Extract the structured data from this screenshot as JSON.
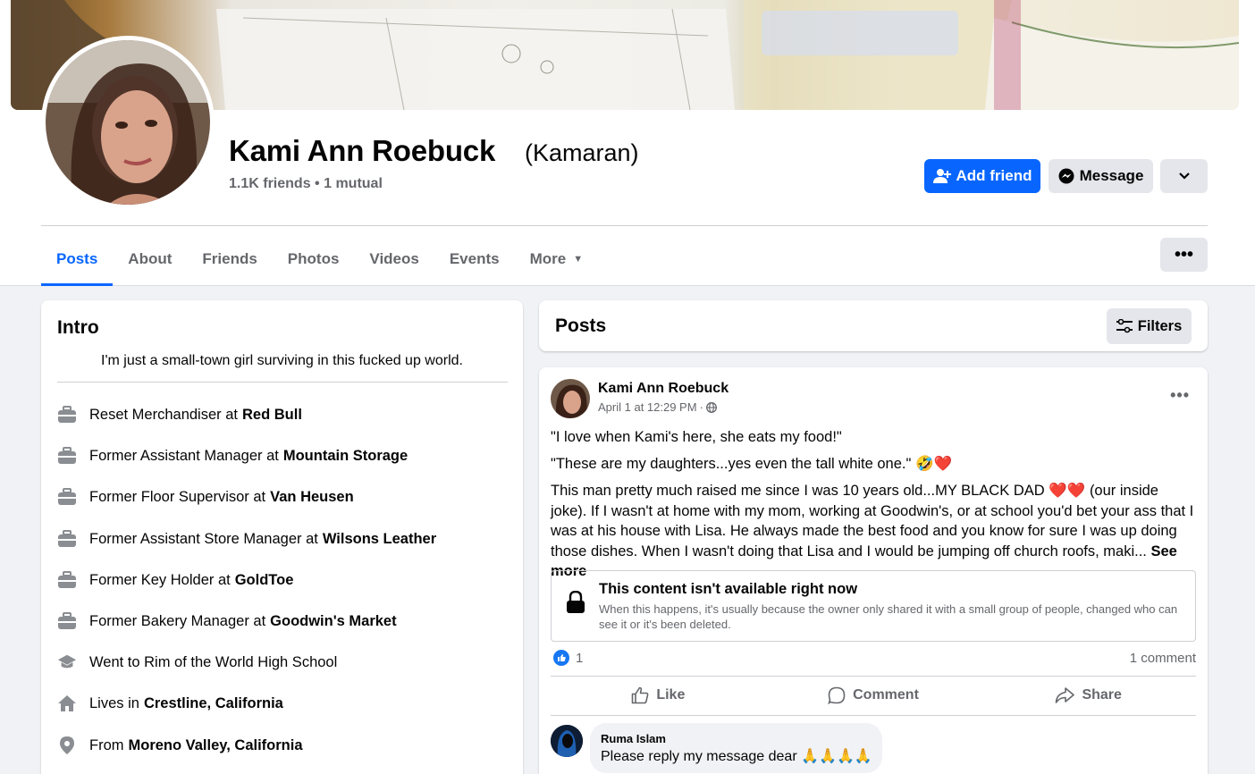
{
  "profile": {
    "name": "Kami Ann Roebuck",
    "alternate_name": "(Kamaran)",
    "friends_count": "1.1K friends",
    "mutual": "1 mutual"
  },
  "actions": {
    "add_friend": "Add friend",
    "message": "Message"
  },
  "tabs": [
    {
      "label": "Posts",
      "active": true
    },
    {
      "label": "About"
    },
    {
      "label": "Friends"
    },
    {
      "label": "Photos"
    },
    {
      "label": "Videos"
    },
    {
      "label": "Events"
    },
    {
      "label": "More"
    }
  ],
  "intro": {
    "title": "Intro",
    "bio": "I'm just a small-town girl surviving in this fucked up world.",
    "items": [
      {
        "icon": "briefcase-icon",
        "text": "Reset Merchandiser at",
        "bold": "Red Bull"
      },
      {
        "icon": "briefcase-icon",
        "text": "Former Assistant Manager at",
        "bold": "Mountain Storage"
      },
      {
        "icon": "briefcase-icon",
        "text": "Former Floor Supervisor at",
        "bold": "Van Heusen"
      },
      {
        "icon": "briefcase-icon",
        "text": "Former Assistant Store Manager at",
        "bold": "Wilsons Leather"
      },
      {
        "icon": "briefcase-icon",
        "text": "Former Key Holder at",
        "bold": "GoldToe"
      },
      {
        "icon": "briefcase-icon",
        "text": "Former Bakery Manager at",
        "bold": "Goodwin's Market"
      },
      {
        "icon": "graduation-cap-icon",
        "text": "Went to Rim of the World High School",
        "bold": ""
      },
      {
        "icon": "home-icon",
        "text": "Lives in",
        "bold": "Crestline, California"
      },
      {
        "icon": "location-pin-icon",
        "text": "From",
        "bold": "Moreno Valley, California"
      }
    ]
  },
  "posts_section": {
    "title": "Posts",
    "filters_label": "Filters"
  },
  "post": {
    "author": "Kami Ann Roebuck",
    "timestamp": "April 1 at 12:29 PM",
    "separator": "·",
    "paragraph1": "\"I love when Kami's here, she eats my food!\"",
    "paragraph2": "\"These are my daughters...yes even the tall white one.\"",
    "paragraph2_emoji": "🤣❤️",
    "paragraph3_a": "This man pretty much raised me since I was 10 years old...MY BLACK DAD",
    "paragraph3_emoji": "❤️❤️",
    "paragraph3_b": "(our inside joke). If I wasn't at home with my mom, working at Goodwin's, or at school you'd bet your ass that I was at his house with Lisa. He always made the best food and you know for sure I was up doing those dishes. When I wasn't doing that Lisa and I would be jumping off church roofs, maki...",
    "see_more": "See more",
    "unavailable_title": "This content isn't available right now",
    "unavailable_desc": "When this happens, it's usually because the owner only shared it with a small group of people, changed who can see it or it's been deleted.",
    "reaction_count": "1",
    "comment_count": "1 comment",
    "like_label": "Like",
    "comment_label": "Comment",
    "share_label": "Share"
  },
  "comment": {
    "author": "Ruma Islam",
    "text": "Please reply my message dear",
    "emoji": "🙏🙏🙏🙏"
  },
  "colors": {
    "brand_blue": "#0866ff",
    "page_bg": "#f0f2f5",
    "secondary_btn": "#e4e6eb",
    "muted_text": "#65676b"
  }
}
